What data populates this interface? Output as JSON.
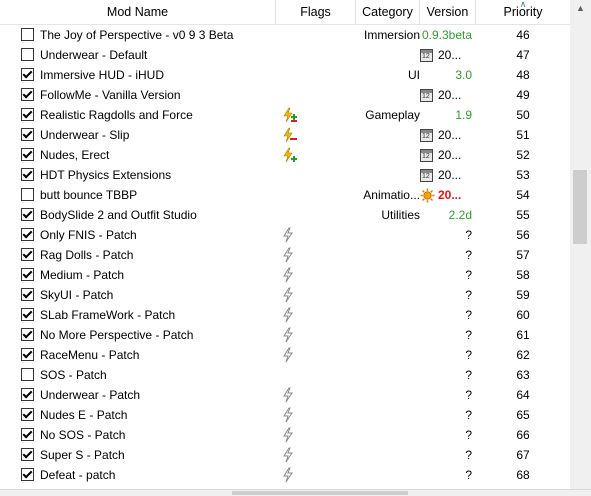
{
  "columns": {
    "name": "Mod Name",
    "flags": "Flags",
    "category": "Category",
    "version": "Version",
    "priority": "Priority"
  },
  "rows": [
    {
      "checked": false,
      "name": "The Joy of Perspective - v0 9 3 Beta",
      "flag": "",
      "category": "Immersion",
      "version": "0.9.3beta",
      "version_style": "green",
      "priority": "46"
    },
    {
      "checked": false,
      "name": "Underwear - Default",
      "flag": "",
      "category": "",
      "version": "20...",
      "version_style": "date",
      "priority": "47"
    },
    {
      "checked": true,
      "name": "Immersive HUD - iHUD",
      "flag": "",
      "category": "UI",
      "version": "3.0",
      "version_style": "green",
      "priority": "48"
    },
    {
      "checked": true,
      "name": "FollowMe - Vanilla Version",
      "flag": "",
      "category": "",
      "version": "20...",
      "version_style": "date",
      "priority": "49"
    },
    {
      "checked": true,
      "name": "Realistic Ragdolls and Force",
      "flag": "conflict-mixed",
      "category": "Gameplay",
      "version": "1.9",
      "version_style": "green",
      "priority": "50"
    },
    {
      "checked": true,
      "name": "Underwear - Slip",
      "flag": "conflict-overwritten",
      "category": "",
      "version": "20...",
      "version_style": "date",
      "priority": "51"
    },
    {
      "checked": true,
      "name": "Nudes, Erect",
      "flag": "conflict-overwrite",
      "category": "",
      "version": "20...",
      "version_style": "date",
      "priority": "52"
    },
    {
      "checked": true,
      "name": "HDT Physics Extensions",
      "flag": "",
      "category": "",
      "version": "20...",
      "version_style": "date",
      "priority": "53"
    },
    {
      "checked": false,
      "name": "butt bounce TBBP",
      "flag": "",
      "category": "Animatio...",
      "version": "20...",
      "version_style": "red",
      "priority": "54"
    },
    {
      "checked": true,
      "name": "BodySlide 2 and Outfit Studio",
      "flag": "",
      "category": "Utilities",
      "version": "2.2d",
      "version_style": "green",
      "priority": "55"
    },
    {
      "checked": true,
      "name": "Only FNIS - Patch",
      "flag": "redundant",
      "category": "",
      "version": "?",
      "version_style": "plain",
      "priority": "56"
    },
    {
      "checked": true,
      "name": "Rag Dolls - Patch",
      "flag": "redundant",
      "category": "",
      "version": "?",
      "version_style": "plain",
      "priority": "57"
    },
    {
      "checked": true,
      "name": "Medium - Patch",
      "flag": "redundant",
      "category": "",
      "version": "?",
      "version_style": "plain",
      "priority": "58"
    },
    {
      "checked": true,
      "name": "SkyUI - Patch",
      "flag": "redundant",
      "category": "",
      "version": "?",
      "version_style": "plain",
      "priority": "59"
    },
    {
      "checked": true,
      "name": "SLab FrameWork - Patch",
      "flag": "redundant",
      "category": "",
      "version": "?",
      "version_style": "plain",
      "priority": "60"
    },
    {
      "checked": true,
      "name": "No More Perspective - Patch",
      "flag": "redundant",
      "category": "",
      "version": "?",
      "version_style": "plain",
      "priority": "61"
    },
    {
      "checked": true,
      "name": "RaceMenu - Patch",
      "flag": "redundant",
      "category": "",
      "version": "?",
      "version_style": "plain",
      "priority": "62"
    },
    {
      "checked": false,
      "name": "SOS - Patch",
      "flag": "",
      "category": "",
      "version": "?",
      "version_style": "plain",
      "priority": "63"
    },
    {
      "checked": true,
      "name": "Underwear - Patch",
      "flag": "redundant",
      "category": "",
      "version": "?",
      "version_style": "plain",
      "priority": "64"
    },
    {
      "checked": true,
      "name": "Nudes E - Patch",
      "flag": "redundant",
      "category": "",
      "version": "?",
      "version_style": "plain",
      "priority": "65"
    },
    {
      "checked": true,
      "name": "No SOS - Patch",
      "flag": "redundant",
      "category": "",
      "version": "?",
      "version_style": "plain",
      "priority": "66"
    },
    {
      "checked": true,
      "name": "Super S - Patch",
      "flag": "redundant",
      "category": "",
      "version": "?",
      "version_style": "plain",
      "priority": "67"
    },
    {
      "checked": true,
      "name": "Defeat - patch",
      "flag": "redundant",
      "category": "",
      "version": "?",
      "version_style": "plain",
      "priority": "68"
    }
  ],
  "colors": {
    "version_green": "#2e9e2e",
    "version_red": "#e81010",
    "conflict_yellow": "#f0c000",
    "conflict_red": "#d42020",
    "conflict_green": "#20a020",
    "sort_arrow": "#3c78c8"
  }
}
